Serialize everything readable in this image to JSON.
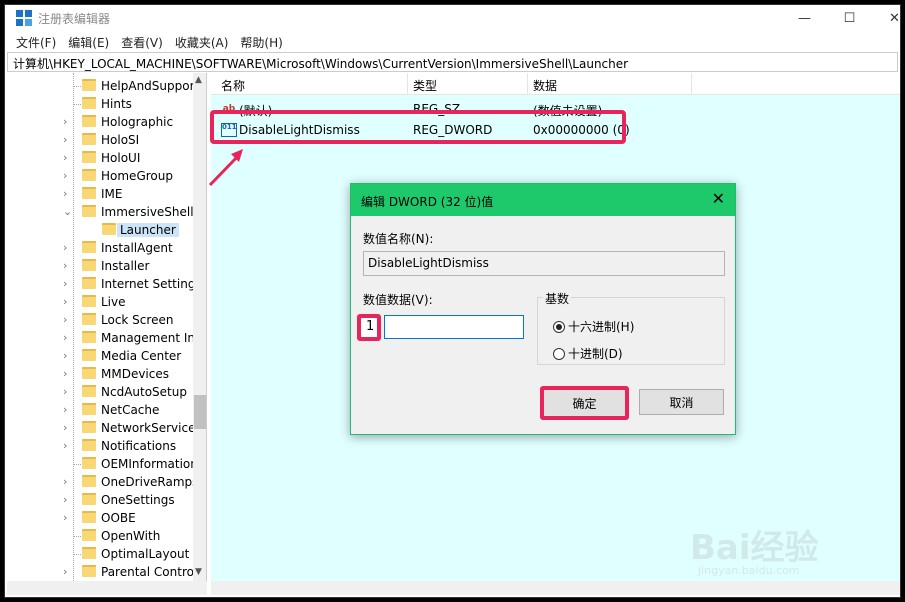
{
  "window": {
    "title": "注册表编辑器",
    "controls": {
      "minimize": "—",
      "maximize": "☐",
      "close": "✕"
    }
  },
  "menu": [
    "文件(F)",
    "编辑(E)",
    "查看(V)",
    "收藏夹(A)",
    "帮助(H)"
  ],
  "address": "计算机\\HKEY_LOCAL_MACHINE\\SOFTWARE\\Microsoft\\Windows\\CurrentVersion\\ImmersiveShell\\Launcher",
  "tree": {
    "items": [
      {
        "label": "HelpAndSupport",
        "expandable": false
      },
      {
        "label": "Hints",
        "expandable": false
      },
      {
        "label": "Holographic",
        "expandable": true
      },
      {
        "label": "HoloSI",
        "expandable": true
      },
      {
        "label": "HoloUI",
        "expandable": true
      },
      {
        "label": "HomeGroup",
        "expandable": true
      },
      {
        "label": "IME",
        "expandable": true
      },
      {
        "label": "ImmersiveShell",
        "expandable": true,
        "expanded": true
      },
      {
        "label": "Launcher",
        "child": true,
        "selected": true
      },
      {
        "label": "InstallAgent",
        "expandable": true
      },
      {
        "label": "Installer",
        "expandable": true
      },
      {
        "label": "Internet Settings",
        "expandable": true
      },
      {
        "label": "Live",
        "expandable": true
      },
      {
        "label": "Lock Screen",
        "expandable": true
      },
      {
        "label": "Management Inf",
        "expandable": true
      },
      {
        "label": "Media Center",
        "expandable": true
      },
      {
        "label": "MMDevices",
        "expandable": true
      },
      {
        "label": "NcdAutoSetup",
        "expandable": true
      },
      {
        "label": "NetCache",
        "expandable": true
      },
      {
        "label": "NetworkServiceT",
        "expandable": true
      },
      {
        "label": "Notifications",
        "expandable": true
      },
      {
        "label": "OEMInformation",
        "expandable": false
      },
      {
        "label": "OneDriveRamps",
        "expandable": true
      },
      {
        "label": "OneSettings",
        "expandable": true
      },
      {
        "label": "OOBE",
        "expandable": true
      },
      {
        "label": "OpenWith",
        "expandable": false
      },
      {
        "label": "OptimalLayout",
        "expandable": false
      },
      {
        "label": "Parental Controls",
        "expandable": true
      }
    ]
  },
  "list": {
    "headers": {
      "name": "名称",
      "type": "类型",
      "data": "数据"
    },
    "rows": [
      {
        "icon": "ab",
        "name": "(默认)",
        "type": "REG_SZ",
        "data": "(数值未设置)"
      },
      {
        "icon": "011",
        "name": "DisableLightDismiss",
        "type": "REG_DWORD",
        "data": "0x00000000 (0)"
      }
    ]
  },
  "dialog": {
    "title": "编辑 DWORD (32 位)值",
    "close": "✕",
    "name_label": "数值名称(N):",
    "name_value": "DisableLightDismiss",
    "data_label": "数值数据(V):",
    "data_value": "1",
    "base_label": "基数",
    "hex_label": "十六进制(H)",
    "dec_label": "十进制(D)",
    "hex_selected": true,
    "ok_label": "确定",
    "cancel_label": "取消"
  },
  "watermark": {
    "brand": "Bai经验",
    "url": "jingyan.baidu.com"
  },
  "colors": {
    "highlight": "#e8255a",
    "dialog_title": "#1ec96b",
    "list_bg": "#e0ffff"
  }
}
